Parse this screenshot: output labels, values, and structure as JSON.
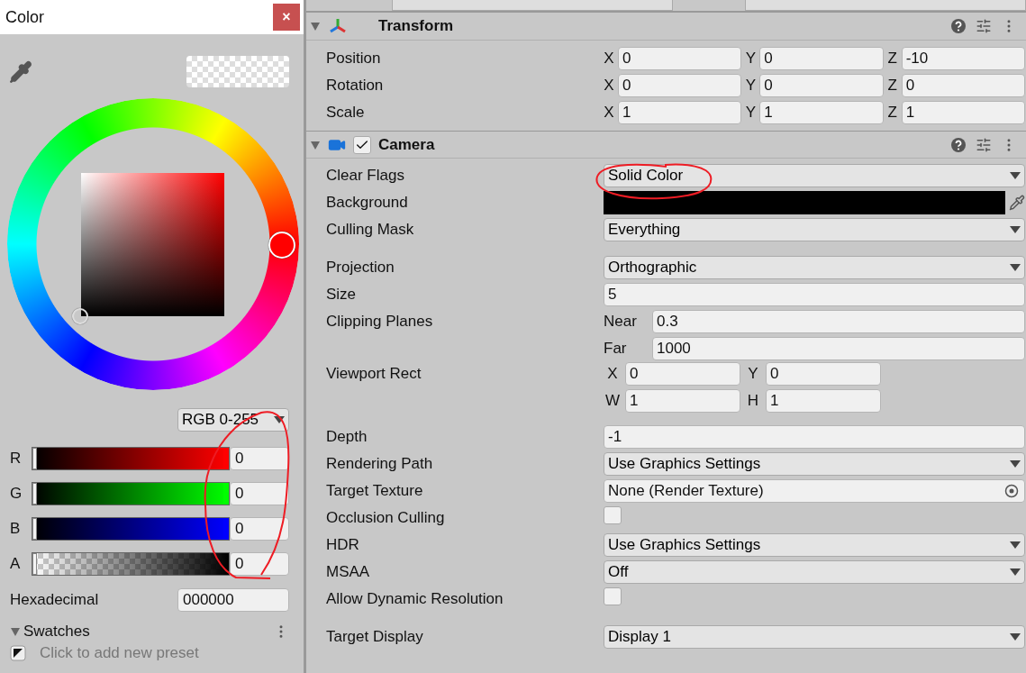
{
  "color_window": {
    "title": "Color",
    "close": "×",
    "mode": "RGB 0-255",
    "channels": [
      {
        "label": "R",
        "kind": "color",
        "color": "#ff0000",
        "level": 0,
        "value": "0"
      },
      {
        "label": "G",
        "kind": "color",
        "color": "#00ff00",
        "level": 0,
        "value": "0"
      },
      {
        "label": "B",
        "kind": "color",
        "color": "#0000ff",
        "level": 0,
        "value": "0"
      },
      {
        "label": "A",
        "kind": "alpha",
        "level": 0,
        "value": "0"
      }
    ],
    "hex_label": "Hexadecimal",
    "hex_value": "000000",
    "swatches": {
      "title": "Swatches",
      "expanded": true,
      "hint": "Click to add new preset"
    }
  },
  "inspector": {
    "transform": {
      "title": "Transform",
      "expanded": true,
      "rows": [
        {
          "label": "Position",
          "axes": [
            {
              "axis": "X",
              "value": "0"
            },
            {
              "axis": "Y",
              "value": "0"
            },
            {
              "axis": "Z",
              "value": "-10"
            }
          ]
        },
        {
          "label": "Rotation",
          "axes": [
            {
              "axis": "X",
              "value": "0"
            },
            {
              "axis": "Y",
              "value": "0"
            },
            {
              "axis": "Z",
              "value": "0"
            }
          ]
        },
        {
          "label": "Scale",
          "axes": [
            {
              "axis": "X",
              "value": "1"
            },
            {
              "axis": "Y",
              "value": "1"
            },
            {
              "axis": "Z",
              "value": "1"
            }
          ]
        }
      ]
    },
    "camera": {
      "title": "Camera",
      "expanded": true,
      "enabled": true,
      "rows": [
        {
          "label": "Clear Flags",
          "kind": "dropdown",
          "value": "Solid Color"
        },
        {
          "label": "Background",
          "kind": "color",
          "color": "#000000"
        },
        {
          "label": "Culling Mask",
          "kind": "dropdown",
          "value": "Everything"
        },
        {
          "label": "Projection",
          "kind": "dropdown",
          "value": "Orthographic",
          "gap_before": true
        },
        {
          "label": "Size",
          "kind": "text",
          "value": "5"
        },
        {
          "label": "Clipping Planes",
          "kind": "planes",
          "fields": [
            {
              "name": "Near",
              "value": "0.3"
            },
            {
              "name": "Far",
              "value": "1000"
            }
          ]
        },
        {
          "label": "Viewport Rect",
          "kind": "rect",
          "fields": [
            {
              "name": "X",
              "value": "0"
            },
            {
              "name": "Y",
              "value": "0"
            },
            {
              "name": "W",
              "value": "1"
            },
            {
              "name": "H",
              "value": "1"
            }
          ]
        },
        {
          "label": "Depth",
          "kind": "text",
          "value": "-1",
          "gap_before": true
        },
        {
          "label": "Rendering Path",
          "kind": "dropdown",
          "value": "Use Graphics Settings"
        },
        {
          "label": "Target Texture",
          "kind": "object",
          "value": "None (Render Texture)"
        },
        {
          "label": "Occlusion Culling",
          "kind": "checkbox",
          "checked": false
        },
        {
          "label": "HDR",
          "kind": "dropdown",
          "value": "Use Graphics Settings"
        },
        {
          "label": "MSAA",
          "kind": "dropdown",
          "value": "Off"
        },
        {
          "label": "Allow Dynamic Resolution",
          "kind": "checkbox",
          "checked": false
        },
        {
          "label": "Target Display",
          "kind": "dropdown",
          "value": "Display 1",
          "gap_before": true
        }
      ]
    }
  },
  "annotations": [
    {
      "kind": "ellipse"
    },
    {
      "kind": "loop"
    }
  ]
}
